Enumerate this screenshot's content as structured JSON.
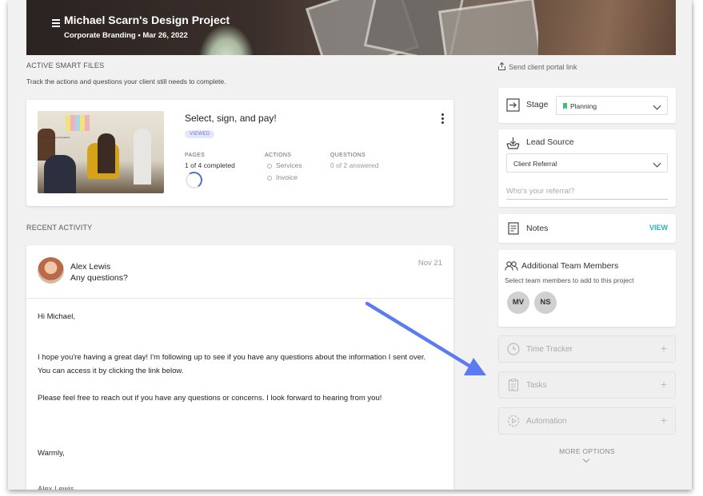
{
  "header": {
    "title": "Michael Scarn's Design Project",
    "subtitle": "Corporate Branding • Mar 26, 2022"
  },
  "smart_files": {
    "section_label": "ACTIVE SMART FILES",
    "description": "Track the actions and questions your client still needs to complete.",
    "card": {
      "title": "Select, sign, and pay!",
      "badge": "VIEWED",
      "image_caption": "j0 you Amazing Innovations",
      "pages_label": "PAGES",
      "pages_value": "1 of 4 completed",
      "progress_fraction": 0.25,
      "actions_label": "ACTIONS",
      "actions": [
        "Services",
        "Invoice"
      ],
      "questions_label": "QUESTIONS",
      "questions_value": "0 of 2 answered"
    }
  },
  "recent_activity": {
    "section_label": "RECENT ACTIVITY",
    "sender": "Alex Lewis",
    "subject": "Any questions?",
    "date": "Nov 21",
    "greeting": "Hi Michael,",
    "paragraph1": "I hope you're having a great day! I'm following up to see if you have any questions about the information I sent over. You can access it by clicking the link below.",
    "paragraph2": "Please feel free to reach out if you have any questions or concerns. I look forward to hearing from you!",
    "closing": "Warmly,",
    "signature_partial": "Alex Lewis"
  },
  "sidebar": {
    "send_link": "Send client portal link",
    "stage": {
      "label": "Stage",
      "value": "Planning",
      "flag_color": "#3dbf72"
    },
    "lead_source": {
      "label": "Lead Source",
      "value": "Client Referral",
      "referral_placeholder": "Who's your referral?"
    },
    "notes": {
      "label": "Notes",
      "view": "VIEW"
    },
    "team": {
      "label": "Additional Team Members",
      "description": "Select team members to add to this project",
      "members": [
        "MV",
        "NS"
      ]
    },
    "time_tracker": "Time Tracker",
    "tasks": "Tasks",
    "automation": "Automation",
    "plus": "+",
    "more_options": "MORE OPTIONS"
  },
  "colors": {
    "accent_teal": "#2bb3b3",
    "arrow_blue": "#5b7cf0",
    "badge_text": "#6a74d6",
    "progress": "#4c6fe0"
  }
}
